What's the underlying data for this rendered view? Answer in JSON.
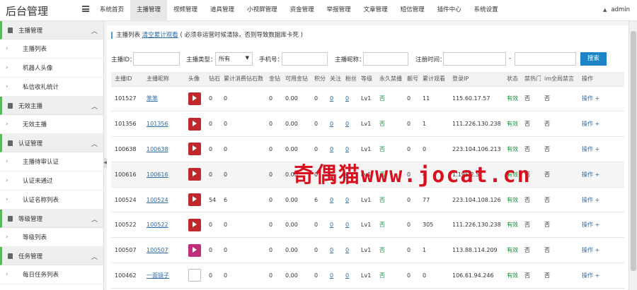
{
  "app": {
    "title": "后台管理",
    "user": "admin"
  },
  "nav": [
    "系统首页",
    "主播管理",
    "视频管理",
    "道具管理",
    "小视屏管理",
    "资金管理",
    "举报管理",
    "文章管理",
    "短信管理",
    "插件中心",
    "系统设置"
  ],
  "nav_active": 1,
  "sidebar": [
    {
      "group": "主播管理",
      "items": [
        "主播列表",
        "机器人头像",
        "私信收礼统计"
      ]
    },
    {
      "group": "无效主播",
      "items": [
        "无效主播"
      ]
    },
    {
      "group": "认证管理",
      "items": [
        "主播待审认证",
        "认证未通过",
        "认证名称列表"
      ]
    },
    {
      "group": "等级管理",
      "items": [
        "等级列表"
      ]
    },
    {
      "group": "任务管理",
      "items": [
        "每日任务列表"
      ]
    }
  ],
  "crumb": {
    "title": "主播列表",
    "link": "清空累计观看",
    "note": "( 必须非运营时候清除，否则导致数据库卡死 )"
  },
  "filters": {
    "id_label": "主播ID：",
    "type_label": "主播类型：",
    "type_value": "所有",
    "phone_label": "手机号：",
    "nick_label": "主播昵称：",
    "date_label": "注册时间：",
    "date_sep": "-",
    "search": "搜索"
  },
  "table": {
    "headers": [
      "主播ID",
      "主播昵称",
      "头像",
      "钻石",
      "累计消费钻石数",
      "金钻",
      "可用金钻",
      "积分",
      "关注",
      "粉丝",
      "等级",
      "永久禁播",
      "靓号",
      "累计观看",
      "登录IP",
      "状态",
      "禁热门",
      "im全局禁言",
      "操作"
    ],
    "rows": [
      {
        "id": "101527",
        "nick": "笨笨",
        "avatar": "red",
        "zs": "0",
        "lj": "0",
        "jz": "0",
        "kyjz": "0.00",
        "jf": "0",
        "gz": "0",
        "fs": "0",
        "lv": "Lv1",
        "jb": "否",
        "lh": "0",
        "gk": "11",
        "ip": "115.60.17.57",
        "st": "有效",
        "jrm": "否",
        "im": "否",
        "op": "操作 +"
      },
      {
        "id": "101356",
        "nick": "101356",
        "avatar": "red",
        "zs": "0",
        "lj": "0",
        "jz": "0",
        "kyjz": "0.00",
        "jf": "0",
        "gz": "0",
        "fs": "0",
        "lv": "Lv1",
        "jb": "否",
        "lh": "0",
        "gk": "1",
        "ip": "111.226.130.238",
        "st": "有效",
        "jrm": "否",
        "im": "否",
        "op": "操作 +"
      },
      {
        "id": "100638",
        "nick": "100638",
        "avatar": "red",
        "zs": "0",
        "lj": "0",
        "jz": "0",
        "kyjz": "0.00",
        "jf": "0",
        "gz": "0",
        "fs": "0",
        "lv": "Lv1",
        "jb": "否",
        "lh": "0",
        "gk": "0",
        "ip": "223.104.106.213",
        "st": "有效",
        "jrm": "否",
        "im": "否",
        "op": "操作 +"
      },
      {
        "id": "100616",
        "nick": "100616",
        "avatar": "red",
        "zs": "0",
        "lj": "0",
        "jz": "0",
        "kyjz": "0.00",
        "jf": "0",
        "gz": "0",
        "fs": "0",
        "lv": "Lv1",
        "jb": "否",
        "lh": "0",
        "gk": "4",
        "ip": "1.195.2.51",
        "st": "有效",
        "jrm": "否",
        "im": "否",
        "op": "操作 +"
      },
      {
        "id": "100524",
        "nick": "100524",
        "avatar": "red",
        "zs": "54",
        "lj": "6",
        "jz": "0",
        "kyjz": "0.00",
        "jf": "6",
        "gz": "0",
        "fs": "0",
        "lv": "Lv1",
        "jb": "否",
        "lh": "0",
        "gk": "77",
        "ip": "223.104.108.126",
        "st": "有效",
        "jrm": "否",
        "im": "否",
        "op": "操作 +"
      },
      {
        "id": "100522",
        "nick": "100522",
        "avatar": "red",
        "zs": "0",
        "lj": "0",
        "jz": "0",
        "kyjz": "0.00",
        "jf": "0",
        "gz": "0",
        "fs": "0",
        "lv": "Lv1",
        "jb": "否",
        "lh": "0",
        "gk": "305",
        "ip": "111.226.130.238",
        "st": "有效",
        "jrm": "否",
        "im": "否",
        "op": "操作 +"
      },
      {
        "id": "100507",
        "nick": "100507",
        "avatar": "pink",
        "zs": "0",
        "lj": "0",
        "jz": "0",
        "kyjz": "0.00",
        "jf": "0",
        "gz": "0",
        "fs": "0",
        "lv": "Lv1",
        "jb": "否",
        "lh": "0",
        "gk": "1",
        "ip": "113.88.114.209",
        "st": "有效",
        "jrm": "否",
        "im": "否",
        "op": "操作 +"
      },
      {
        "id": "100462",
        "nick": "一面镜子",
        "avatar": "broken",
        "zs": "0",
        "lj": "0",
        "jz": "0",
        "kyjz": "0.00",
        "jf": "0",
        "gz": "0",
        "fs": "0",
        "lv": "Lv1",
        "jb": "否",
        "lh": "0",
        "gk": "0",
        "ip": "106.61.94.246",
        "st": "有效",
        "jrm": "否",
        "im": "否",
        "op": "操作 +"
      }
    ]
  },
  "watermark": "奇偶猫www.jocat.cn",
  "colors": {
    "accent": "#1c84c6",
    "sidebar_accent": "#5cb85c",
    "valid": "#1a8c3a",
    "link": "#2a6aa5"
  }
}
